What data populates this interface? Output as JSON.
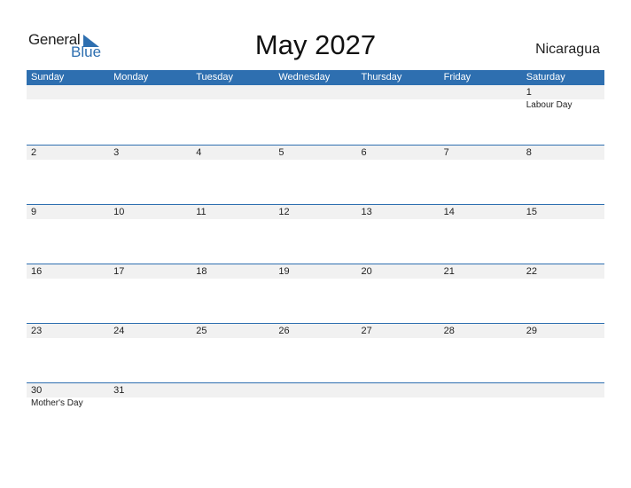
{
  "logo": {
    "general": "General",
    "blue": "Blue"
  },
  "header": {
    "title": "May 2027",
    "country": "Nicaragua"
  },
  "colors": {
    "accent": "#2e6fb0",
    "day_row_bg": "#f1f1f1"
  },
  "days_of_week": [
    "Sunday",
    "Monday",
    "Tuesday",
    "Wednesday",
    "Thursday",
    "Friday",
    "Saturday"
  ],
  "weeks": [
    {
      "days": [
        "",
        "",
        "",
        "",
        "",
        "",
        "1"
      ],
      "events": [
        "",
        "",
        "",
        "",
        "",
        "",
        "Labour Day"
      ]
    },
    {
      "days": [
        "2",
        "3",
        "4",
        "5",
        "6",
        "7",
        "8"
      ],
      "events": [
        "",
        "",
        "",
        "",
        "",
        "",
        ""
      ]
    },
    {
      "days": [
        "9",
        "10",
        "11",
        "12",
        "13",
        "14",
        "15"
      ],
      "events": [
        "",
        "",
        "",
        "",
        "",
        "",
        ""
      ]
    },
    {
      "days": [
        "16",
        "17",
        "18",
        "19",
        "20",
        "21",
        "22"
      ],
      "events": [
        "",
        "",
        "",
        "",
        "",
        "",
        ""
      ]
    },
    {
      "days": [
        "23",
        "24",
        "25",
        "26",
        "27",
        "28",
        "29"
      ],
      "events": [
        "",
        "",
        "",
        "",
        "",
        "",
        ""
      ]
    },
    {
      "days": [
        "30",
        "31",
        "",
        "",
        "",
        "",
        ""
      ],
      "events": [
        "Mother's Day",
        "",
        "",
        "",
        "",
        "",
        ""
      ]
    }
  ]
}
